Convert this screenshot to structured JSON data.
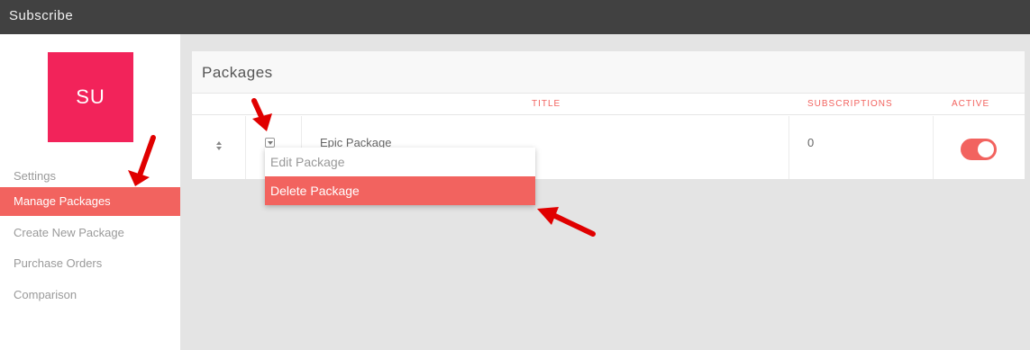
{
  "topbar": {
    "title": "Subscribe"
  },
  "sidebar": {
    "logo_text": "SU",
    "items": [
      {
        "label": "Settings",
        "active": false
      },
      {
        "label": "Manage Packages",
        "active": true
      },
      {
        "label": "Create New Package",
        "active": false
      },
      {
        "label": "Purchase Orders",
        "active": false
      },
      {
        "label": "Comparison",
        "active": false
      }
    ]
  },
  "panel": {
    "title": "Packages",
    "columns": {
      "title": "TITLE",
      "subscriptions": "SUBSCRIPTIONS",
      "active": "ACTIVE"
    },
    "rows": [
      {
        "title": "Epic Package",
        "subscriptions": "0",
        "active": true
      }
    ]
  },
  "dropdown": {
    "items": [
      "Edit Package",
      "Delete Package"
    ]
  },
  "colors": {
    "accent": "#f2635f",
    "logo": "#f2235a",
    "topbar": "#414141",
    "annotation_arrow": "#e00000"
  }
}
